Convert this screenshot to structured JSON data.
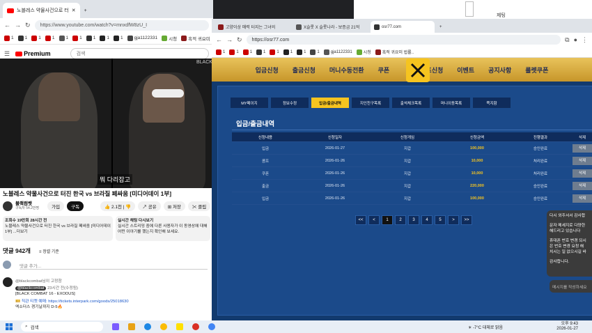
{
  "left_window": {
    "tabs": [
      {
        "label": "노블레스 약물사건으로 터",
        "icon": "youtube"
      }
    ],
    "url": "https://www.youtube.com/watch?v=mnxdfW8zU_I",
    "bookmarks": [
      "1",
      "1",
      "1",
      "1",
      "1",
      "1",
      "1",
      "1",
      "1",
      "gja1122331",
      "시청",
      "흑적 귀요미 법률.."
    ],
    "youtube": {
      "logo": "Premium",
      "search_placeholder": "검색",
      "caption": "뭐 다리잡고",
      "watermark": "BLACK",
      "title": "노블레스 약물사건으로 터진 한국 vs 브라질 페싸움 [미디어데이 1부]",
      "channel": "블랙컴뱃",
      "subs": "구독자 54.2만명",
      "join": "가입",
      "subscribe": "구독",
      "likes": "2.1천",
      "share": "공유",
      "save": "저장",
      "clip": "클립",
      "desc_meta": "조회수 19만회 28시간 전",
      "desc_text": "노블레스 약물사건으로 터진 한국 vs 브라질 페싸움 [미디어데이 1부] ...더보기",
      "chat_title": "실시간 채팅 다시보기",
      "chat_text": "실시간 스트리밍 중에 다른 사용자가 이 동영상에 대해 어떤 이야기를 했는지 확인해 보세요.",
      "comments_header": "댓글 942개",
      "sort": "정렬 기준",
      "add_comment": "댓글 추가...",
      "comment_tag": "@blackcombat님이 고정함",
      "comment_user": "@blackcombat",
      "comment_time": "23시간 전(수정됨)",
      "comment_lines": [
        "[BLACK COMBAT 16 - EXODUS]",
        "🎫 직관 티켓 예매: https://tickets.interpark.com/goods/25018630",
        "엑소더스 경기날까지 D-5🔥"
      ]
    }
  },
  "right_window": {
    "tabs": [
      {
        "label": "고양이상 매력 터지는 그녀의"
      },
      {
        "label": "X슬롯 X 슬롯나라 - 보증금 21억"
      },
      {
        "label": "osr77.com"
      }
    ],
    "url": "https://osr77.com",
    "bookmarks": [
      "1",
      "1",
      "1",
      "1",
      "1",
      "1",
      "1",
      "1",
      "gja1122331",
      "시청",
      "흑적 귀요미 법률.."
    ],
    "site_nav": [
      "입금신청",
      "출금신청",
      "머니수동전환",
      "쿠폰",
      "콤프신청",
      "이벤트",
      "공지사항",
      "룰렛쿠폰"
    ],
    "sub_tabs": [
      "MY페이지",
      "정보수정",
      "입금/출금내역",
      "지인친구목록",
      "출석체크목록",
      "머니이동목록",
      "쪽지함"
    ],
    "active_sub_tab": 2,
    "panel_title": "입금/출금내역",
    "table": {
      "headers": [
        "신청내용",
        "신청일자",
        "신청게임",
        "신청금액",
        "진행결과",
        "삭제"
      ],
      "rows": [
        {
          "type": "입금",
          "date": "2026-01-27",
          "game": "지갑",
          "amount": "100,000",
          "result": "승인완료",
          "del": "삭제"
        },
        {
          "type": "콤프",
          "date": "2026-01-26",
          "game": "지갑",
          "amount": "10,000",
          "result": "처리완료",
          "del": "삭제"
        },
        {
          "type": "쿠폰",
          "date": "2026-01-26",
          "game": "지갑",
          "amount": "10,000",
          "result": "처리완료",
          "del": "삭제"
        },
        {
          "type": "출금",
          "date": "2026-01-26",
          "game": "지갑",
          "amount": "220,000",
          "result": "승인완료",
          "del": "삭제"
        },
        {
          "type": "입금",
          "date": "2026-01-26",
          "game": "지갑",
          "amount": "100,000",
          "result": "승인완료",
          "del": "삭제"
        }
      ]
    },
    "pager": [
      "<<",
      "<",
      "1",
      "2",
      "3",
      "4",
      "5",
      ">",
      ">>"
    ],
    "chat_messages": [
      "다시 외주서서 감사합",
      "문자 메세지로 다양한",
      "해드리고 있습니다",
      "휴대폰 번호 변경 되시",
      "은 번호 변경 요청 해",
      "치시는 일 없으시길 바",
      "감사합니다."
    ],
    "chat_placeholder": "메시지를 작성하세요"
  },
  "top_right": {
    "label": "제팅"
  },
  "taskbar": {
    "search": "검색",
    "weather": "-7°C 대체로 맑음",
    "time": "오후 9:43",
    "date": "2026-01-27"
  }
}
